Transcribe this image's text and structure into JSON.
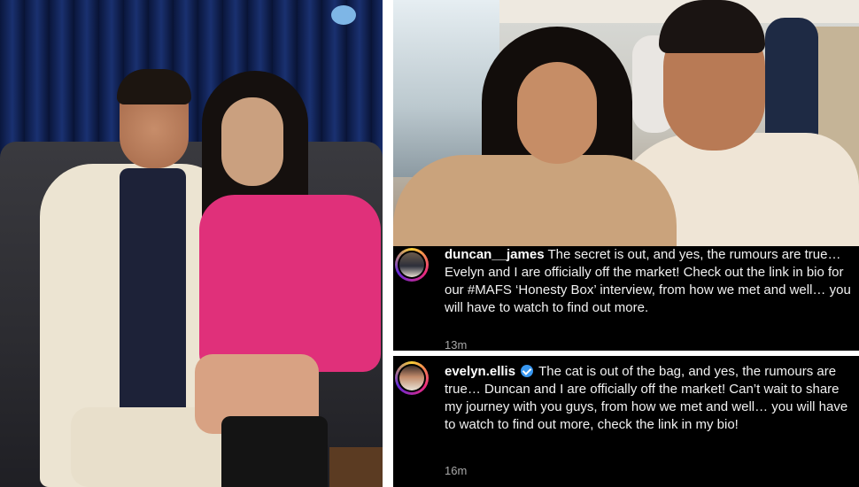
{
  "comments": [
    {
      "username": "duncan__james",
      "verified": false,
      "text": "The secret is out, and yes, the rumours are true… Evelyn and I are officially off the market! Check out the link in bio for our #MAFS ‘Honesty Box’ interview, from how we met and well… you will have to watch to find out more.",
      "time": "13m"
    },
    {
      "username": "evelyn.ellis",
      "verified": true,
      "text": "The cat is out of the bag, and yes, the rumours are true… Duncan and I are officially off the market! Can’t wait to share my journey with you guys, from how we met and well… you will have to watch to find out more, check the link in my bio!",
      "time": "16m"
    }
  ],
  "colors": {
    "panel_bg": "#000000",
    "verified_badge": "#3897f0",
    "blazer": "#e0307a"
  }
}
